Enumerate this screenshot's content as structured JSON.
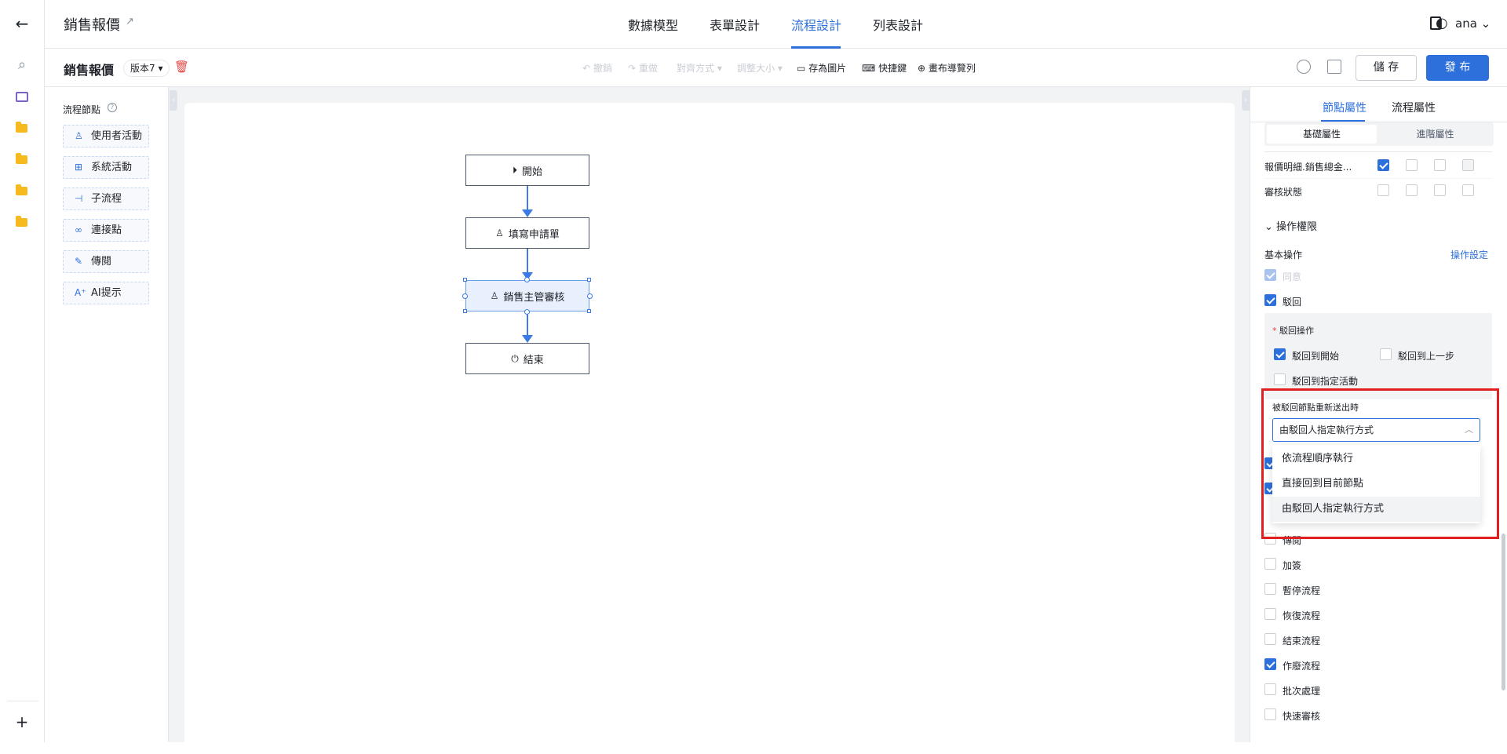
{
  "header": {
    "app_title": "銷售報價",
    "tabs": [
      "數據模型",
      "表單設計",
      "流程設計",
      "列表設計"
    ],
    "active_tab": "流程設計",
    "user": "ana"
  },
  "toolbar": {
    "title": "銷售報價",
    "version": "版本7",
    "undo": "撤銷",
    "redo": "重做",
    "align": "對齊方式",
    "resize": "調整大小",
    "save_image": "存為圖片",
    "shortcuts": "快捷鍵",
    "canvas_nav": "畫布導覽列",
    "save": "儲 存",
    "publish": "發 布"
  },
  "palette": {
    "title": "流程節點",
    "items": [
      "使用者活動",
      "系統活動",
      "子流程",
      "連接點",
      "傳閱",
      "AI提示"
    ]
  },
  "flow": {
    "nodes": [
      "開始",
      "填寫申請單",
      "銷售主管審核",
      "結束"
    ]
  },
  "panel": {
    "tabs": [
      "節點屬性",
      "流程屬性"
    ],
    "seg": [
      "基礎屬性",
      "進階屬性"
    ],
    "field_rows": [
      "報價明細.銷售總金...",
      "審核狀態"
    ],
    "perm_section": "操作權限",
    "basic_ops": "基本操作",
    "ops_setting": "操作設定",
    "op_agree": "同意",
    "op_reject": "駁回",
    "reject_title": "駁回操作",
    "reject_opts": [
      "駁回到開始",
      "駁回到上一步",
      "駁回到指定活動"
    ],
    "resend_title": "被駁回節點重新送出時",
    "select_value": "由駁回人指定執行方式",
    "dropdown_options": [
      "依流程順序執行",
      "直接回到目前節點",
      "由駁回人指定執行方式"
    ],
    "more_ops": [
      "傳閱",
      "加簽",
      "暫停流程",
      "恢復流程",
      "結束流程",
      "作廢流程",
      "批次處理",
      "快速審核"
    ],
    "more_ops_checked": [
      false,
      false,
      false,
      false,
      false,
      true,
      false,
      false
    ]
  }
}
